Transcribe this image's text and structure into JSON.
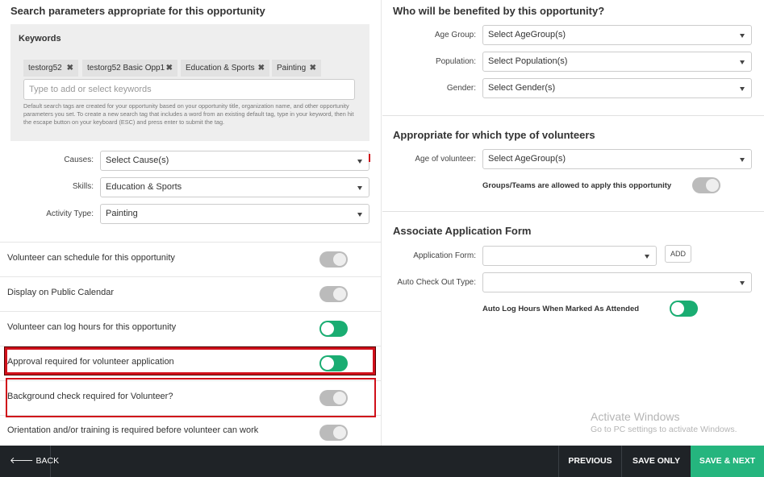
{
  "left": {
    "search_title": "Search parameters appropriate for this opportunity",
    "keywords": {
      "label": "Keywords",
      "tags": [
        "testorg52",
        "testorg52 Basic Opp1",
        "Education & Sports",
        "Painting"
      ],
      "placeholder": "Type to add or select keywords",
      "help": "Default search tags are created for your opportunity based on your opportunity title, organization name, and other opportunity parameters you set. To create a new search tag that includes a word from an existing default tag, type in your keyword, then hit the escape button on your keyboard (ESC) and press enter to submit the tag."
    },
    "causes": {
      "label": "Causes:",
      "value": "Select Cause(s)"
    },
    "skills": {
      "label": "Skills:",
      "value": "Education & Sports"
    },
    "activity_type": {
      "label": "Activity Type:",
      "value": "Painting"
    },
    "settings": [
      {
        "label": "Volunteer can schedule for this opportunity",
        "on": false
      },
      {
        "label": "Display on Public Calendar",
        "on": false
      },
      {
        "label": "Volunteer can log hours for this opportunity",
        "on": true
      },
      {
        "label": "Approval required for volunteer application",
        "on": true
      },
      {
        "label": "Background check required for Volunteer?",
        "on": false
      },
      {
        "label": "Orientation and/or training is required before volunteer can work",
        "on": false
      }
    ]
  },
  "right": {
    "benefit_title": "Who will be benefited by this opportunity?",
    "age_group": {
      "label": "Age Group:",
      "value": "Select AgeGroup(s)"
    },
    "population": {
      "label": "Population:",
      "value": "Select Population(s)"
    },
    "gender": {
      "label": "Gender:",
      "value": "Select Gender(s)"
    },
    "volunteer_type_title": "Appropriate for which type of volunteers",
    "age_of_volunteer": {
      "label": "Age of volunteer:",
      "value": "Select AgeGroup(s)"
    },
    "groups_allowed": {
      "label": "Groups/Teams are allowed to apply this opportunity",
      "on": false
    },
    "application_title": "Associate Application Form",
    "application_form": {
      "label": "Application Form:",
      "value": "",
      "add_label": "ADD"
    },
    "auto_checkout": {
      "label": "Auto Check Out Type:",
      "value": ""
    },
    "auto_log_hours": {
      "label": "Auto Log Hours When Marked As Attended",
      "on": true
    }
  },
  "watermark": {
    "title": "Activate Windows",
    "subtitle": "Go to PC settings to activate Windows."
  },
  "footer": {
    "back_label": "BACK",
    "previous_label": "PREVIOUS",
    "save_only_label": "SAVE ONLY",
    "save_next_label": "SAVE & NEXT"
  },
  "colors": {
    "toggle_on": "#1aad72",
    "toggle_off": "#bbbbbb",
    "highlight": "#d0101a",
    "footer_bg": "#1f2327",
    "save_next_bg": "#25b57e"
  }
}
